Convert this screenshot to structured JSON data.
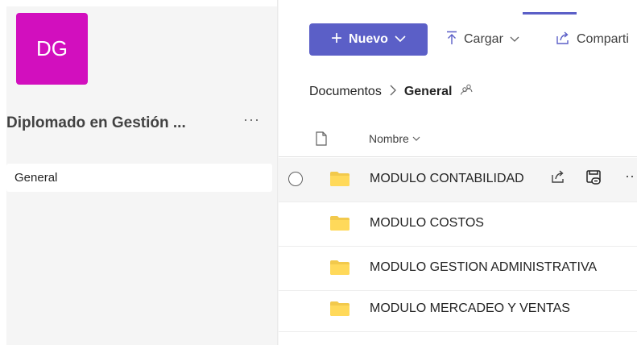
{
  "team": {
    "initials": "DG",
    "name": "Diplomado en Gestión ...",
    "more": "···",
    "avatar_color": "#d20fbe"
  },
  "channels": [
    {
      "label": "General",
      "selected": true
    }
  ],
  "toolbar": {
    "new_label": "Nuevo",
    "upload_label": "Cargar",
    "share_label": "Comparti",
    "accent": "#5b5fc7"
  },
  "breadcrumb": {
    "root": "Documentos",
    "current": "General"
  },
  "columns": {
    "name": "Nombre"
  },
  "files": [
    {
      "name": "MODULO CONTABILIDAD",
      "type": "folder"
    },
    {
      "name": "MODULO COSTOS",
      "type": "folder"
    },
    {
      "name": "MODULO GESTION ADMINISTRATIVA",
      "type": "folder"
    },
    {
      "name": "MODULO MERCADEO Y VENTAS",
      "type": "folder"
    }
  ],
  "row_more": "··"
}
